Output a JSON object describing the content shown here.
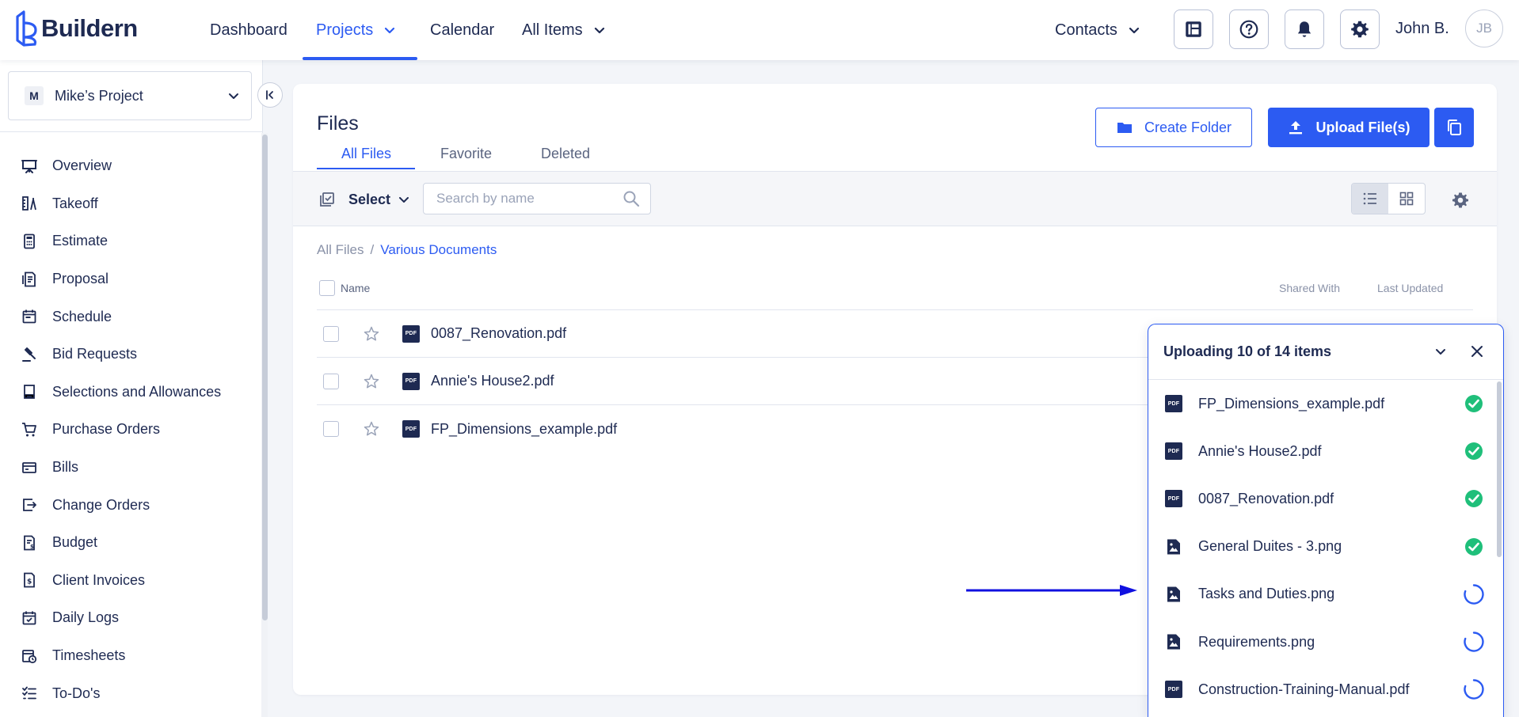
{
  "brand": {
    "name": "Buildern",
    "accent": "#2c5bf2",
    "navy": "#1e2a52"
  },
  "topnav": {
    "items": [
      {
        "label": "Dashboard",
        "active": false,
        "dropdown": false
      },
      {
        "label": "Projects",
        "active": true,
        "dropdown": true
      },
      {
        "label": "Calendar",
        "active": false,
        "dropdown": false
      },
      {
        "label": "All Items",
        "active": false,
        "dropdown": true
      }
    ],
    "contacts_label": "Contacts",
    "icons": [
      "layout-icon",
      "help-icon",
      "bell-icon",
      "gear-icon"
    ],
    "user_name": "John B.",
    "user_initials": "JB"
  },
  "sidebar": {
    "project_initial": "M",
    "project_name": "Mike’s Project",
    "items": [
      {
        "label": "Overview",
        "icon": "presentation-icon"
      },
      {
        "label": "Takeoff",
        "icon": "takeoff-icon"
      },
      {
        "label": "Estimate",
        "icon": "calculator-icon"
      },
      {
        "label": "Proposal",
        "icon": "proposal-icon"
      },
      {
        "label": "Schedule",
        "icon": "calendar-icon"
      },
      {
        "label": "Bid Requests",
        "icon": "gavel-icon"
      },
      {
        "label": "Selections and Allowances",
        "icon": "selections-icon"
      },
      {
        "label": "Purchase Orders",
        "icon": "cart-icon"
      },
      {
        "label": "Bills",
        "icon": "bills-icon"
      },
      {
        "label": "Change Orders",
        "icon": "change-orders-icon"
      },
      {
        "label": "Budget",
        "icon": "budget-icon"
      },
      {
        "label": "Client Invoices",
        "icon": "invoice-icon"
      },
      {
        "label": "Daily Logs",
        "icon": "daily-log-icon"
      },
      {
        "label": "Timesheets",
        "icon": "timesheet-icon"
      },
      {
        "label": "To-Do's",
        "icon": "todo-icon"
      }
    ]
  },
  "files": {
    "title": "Files",
    "tabs": [
      "All Files",
      "Favorite",
      "Deleted"
    ],
    "active_tab": "All Files",
    "create_folder_label": "Create Folder",
    "upload_label": "Upload File(s)",
    "select_label": "Select",
    "search_placeholder": "Search by name",
    "view_mode": "list",
    "breadcrumb": {
      "root": "All Files",
      "separator": "/",
      "current": "Various Documents"
    },
    "columns": {
      "name": "Name",
      "shared": "Shared With",
      "updated": "Last Updated"
    },
    "rows": [
      {
        "name": "0087_Renovation.pdf",
        "type": "pdf"
      },
      {
        "name": "Annie's House2.pdf",
        "type": "pdf"
      },
      {
        "name": "FP_Dimensions_example.pdf",
        "type": "pdf"
      }
    ]
  },
  "upload_panel": {
    "title": "Uploading 10 of 14 items",
    "items": [
      {
        "name": "FP_Dimensions_example.pdf",
        "type": "pdf",
        "status": "done"
      },
      {
        "name": "Annie's House2.pdf",
        "type": "pdf",
        "status": "done"
      },
      {
        "name": "0087_Renovation.pdf",
        "type": "pdf",
        "status": "done"
      },
      {
        "name": "General Duites - 3.png",
        "type": "image",
        "status": "done"
      },
      {
        "name": "Tasks and Duties.png",
        "type": "image",
        "status": "uploading"
      },
      {
        "name": "Requirements.png",
        "type": "image",
        "status": "uploading"
      },
      {
        "name": "Construction-Training-Manual.pdf",
        "type": "pdf",
        "status": "uploading"
      }
    ],
    "success_color": "#1fbf7a"
  },
  "pdf_badge_text": "PDF"
}
